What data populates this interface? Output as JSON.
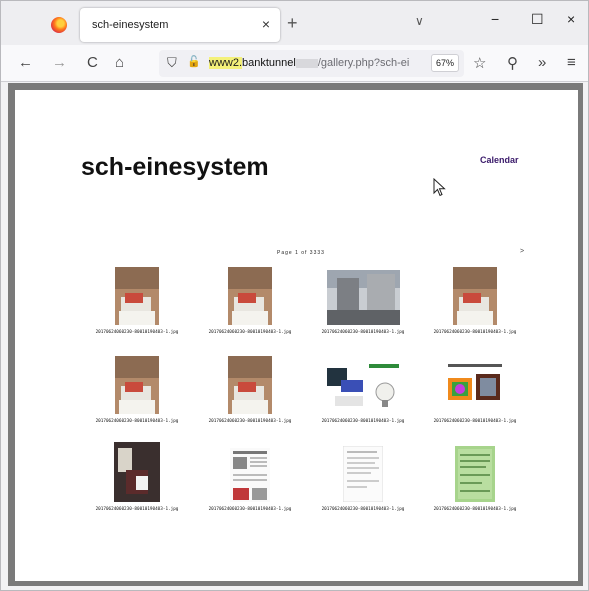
{
  "browser": {
    "tab_title": "sch-einesystem",
    "tab_close": "×",
    "new_tab": "+",
    "tabs_list": "∨",
    "minimize": "−",
    "maximize": "☐",
    "close": "×",
    "url_highlight": "www2.",
    "url_host": "banktunnel",
    "url_path": "/gallery.php?sch-ei",
    "zoom": "67%",
    "back": "←",
    "forward": "→",
    "reload": "C",
    "home": "⌂",
    "shield": "⛉",
    "lock": "🔓",
    "bookmark": "☆",
    "extensions": "⚲",
    "overflow": "»",
    "menu": "≡"
  },
  "page": {
    "title": "sch-einesystem",
    "calendar_link": "Calendar",
    "pager": "Page 1 of 3333",
    "pager_next": ">"
  },
  "gallery": [
    {
      "caption": "20170624060230-80010190403-1.jpg",
      "kind": "photo-papers"
    },
    {
      "caption": "20170624060230-80010190403-1.jpg",
      "kind": "photo-papers"
    },
    {
      "caption": "20170624060230-80010190403-1.jpg",
      "kind": "photo-building"
    },
    {
      "caption": "20170624060230-80010190403-1.jpg",
      "kind": "photo-papers"
    },
    {
      "caption": "20170624060230-80010190403-1.jpg",
      "kind": "photo-papers"
    },
    {
      "caption": "20170624060230-80010190403-1.jpg",
      "kind": "photo-papers"
    },
    {
      "caption": "20170624060230-80010190403-1.jpg",
      "kind": "poster-bulb"
    },
    {
      "caption": "20170624060230-80010190403-1.jpg",
      "kind": "poster-colors"
    },
    {
      "caption": "20170624060230-80010190403-1.jpg",
      "kind": "photo-dark"
    },
    {
      "caption": "20170624060230-80010190403-1.jpg",
      "kind": "doc-article"
    },
    {
      "caption": "20170624060230-80010190403-1.jpg",
      "kind": "doc-text"
    },
    {
      "caption": "20170624060230-80010190403-1.jpg",
      "kind": "doc-green"
    }
  ]
}
